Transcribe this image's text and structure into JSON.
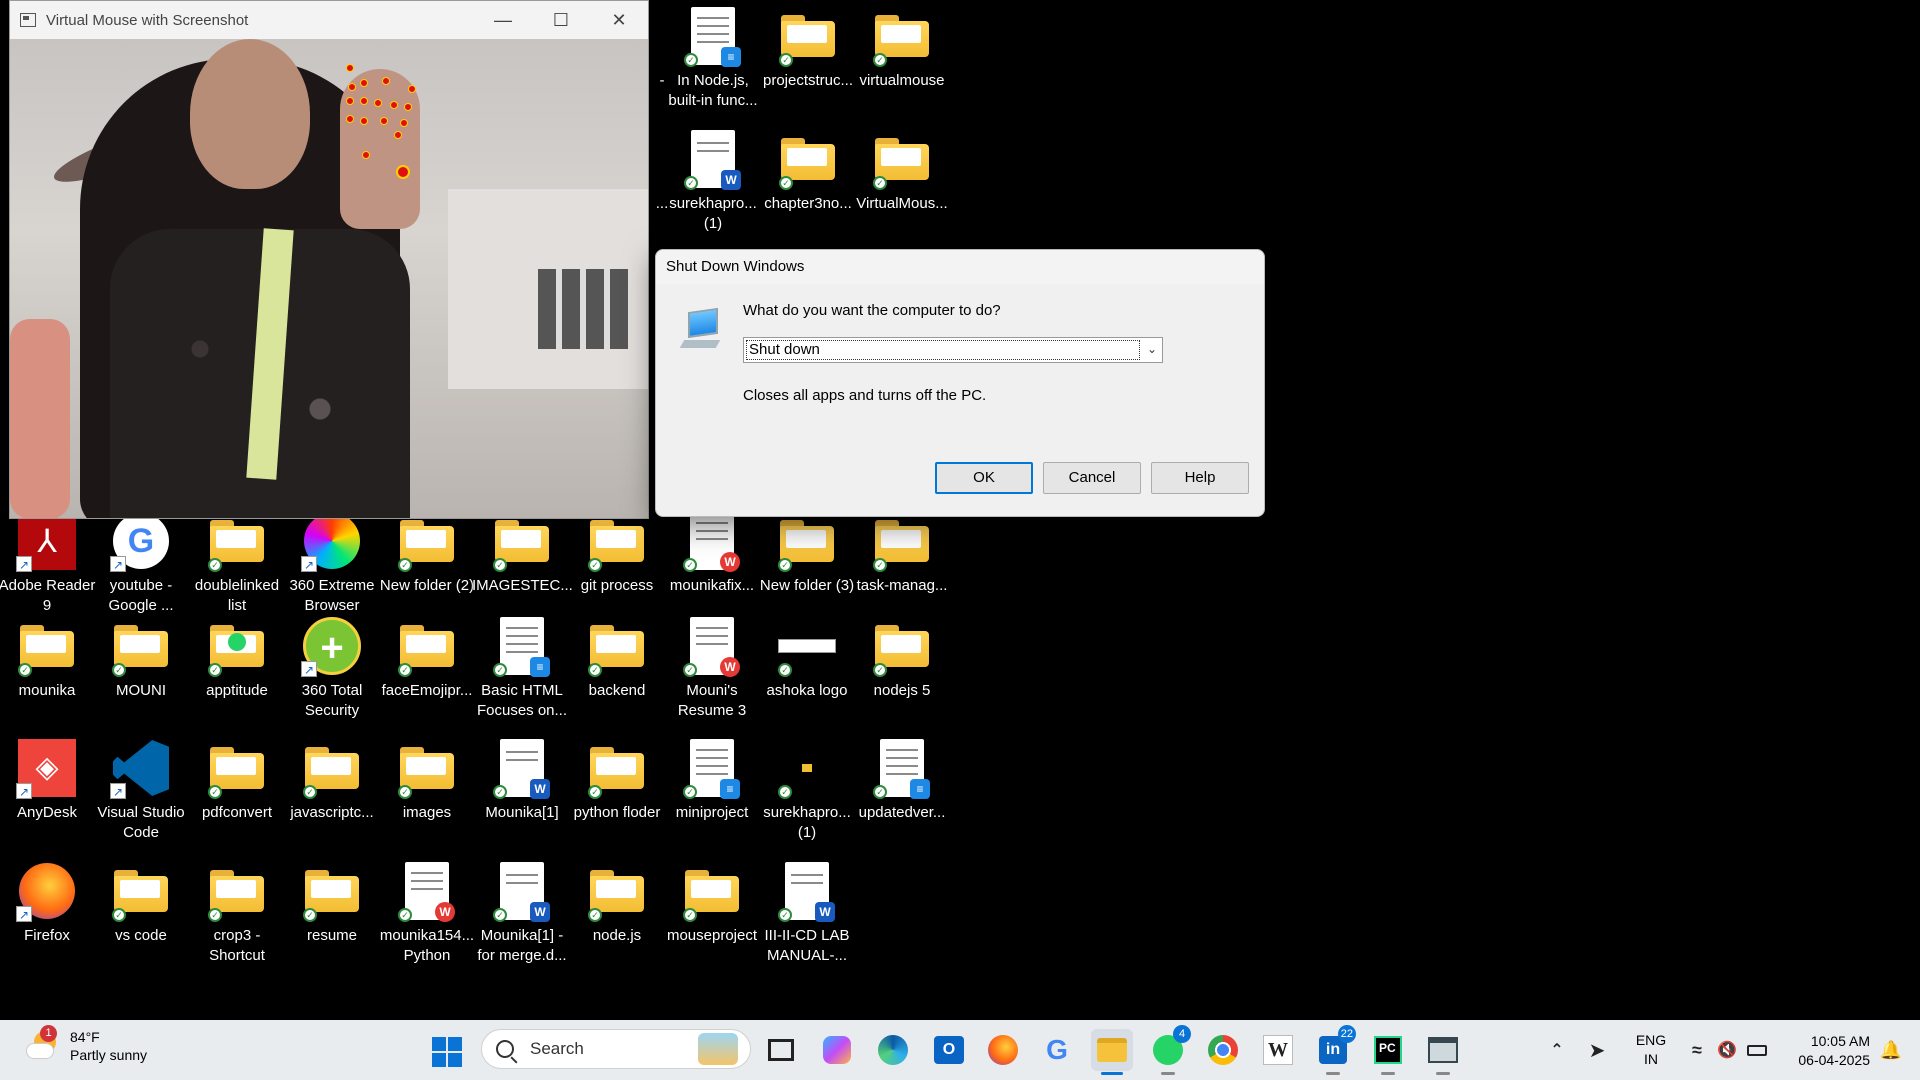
{
  "camera_window": {
    "title": "Virtual Mouse with Screenshot",
    "minimize": "—",
    "maximize": "☐",
    "close": "✕"
  },
  "dialog": {
    "title": "Shut Down Windows",
    "question": "What do you want the computer to do?",
    "selected_option": "Shut down",
    "description": "Closes all apps and turns off the PC.",
    "ok_label": "OK",
    "cancel_label": "Cancel",
    "help_label": "Help"
  },
  "desktop": {
    "top_icons": [
      {
        "label": "-",
        "kind": "dash"
      },
      {
        "label": "In Node.js, built-in func...",
        "kind": "doc-blue"
      },
      {
        "label": "projectstruc...",
        "kind": "folder"
      },
      {
        "label": "virtualmouse",
        "kind": "folder"
      },
      {
        "label": "...",
        "kind": "dash"
      },
      {
        "label": "surekhapro... (1)",
        "kind": "word"
      },
      {
        "label": "chapter3no...",
        "kind": "folder"
      },
      {
        "label": "VirtualMous...",
        "kind": "folder"
      }
    ],
    "row1": [
      {
        "label": "Adobe Reader 9",
        "kind": "adobe"
      },
      {
        "label": "youtube - Google ...",
        "kind": "google"
      },
      {
        "label": "doublelinked list",
        "kind": "folder"
      },
      {
        "label": "360 Extreme Browser",
        "kind": "browser360"
      },
      {
        "label": "New folder (2)",
        "kind": "folder"
      },
      {
        "label": "IMAGESTEC...",
        "kind": "folder"
      },
      {
        "label": "git process",
        "kind": "folder"
      },
      {
        "label": "mounikafix...",
        "kind": "doc-wps"
      },
      {
        "label": "New folder (3)",
        "kind": "folder"
      },
      {
        "label": "task-manag...",
        "kind": "folder"
      }
    ],
    "row2": [
      {
        "label": "mounika",
        "kind": "folder"
      },
      {
        "label": "MOUNI",
        "kind": "folder"
      },
      {
        "label": "apptitude",
        "kind": "folder-wa"
      },
      {
        "label": "360 Total Security",
        "kind": "security360"
      },
      {
        "label": "faceEmojipr...",
        "kind": "folder"
      },
      {
        "label": "Basic HTML Focuses on...",
        "kind": "doc-blue"
      },
      {
        "label": "backend",
        "kind": "folder"
      },
      {
        "label": "Mouni's Resume 3",
        "kind": "doc-wps"
      },
      {
        "label": "ashoka logo",
        "kind": "image"
      },
      {
        "label": "nodejs 5",
        "kind": "folder"
      }
    ],
    "row3": [
      {
        "label": "AnyDesk",
        "kind": "anydesk"
      },
      {
        "label": "Visual Studio Code",
        "kind": "vscode"
      },
      {
        "label": "pdfconvert",
        "kind": "folder"
      },
      {
        "label": "javascriptc...",
        "kind": "folder"
      },
      {
        "label": "images",
        "kind": "folder"
      },
      {
        "label": "Mounika[1]",
        "kind": "word"
      },
      {
        "label": "python floder",
        "kind": "folder"
      },
      {
        "label": "miniproject",
        "kind": "doc-blue"
      },
      {
        "label": "surekhapro... (1)",
        "kind": "tiny"
      },
      {
        "label": "updatedver...",
        "kind": "doc-blue"
      }
    ],
    "row4": [
      {
        "label": "Firefox",
        "kind": "firefox"
      },
      {
        "label": "vs code",
        "kind": "folder"
      },
      {
        "label": "crop3 - Shortcut",
        "kind": "folder"
      },
      {
        "label": "resume",
        "kind": "folder"
      },
      {
        "label": "mounika154... Python",
        "kind": "doc-wps"
      },
      {
        "label": "Mounika[1] - for merge.d...",
        "kind": "word"
      },
      {
        "label": "node.js",
        "kind": "folder"
      },
      {
        "label": "mouseproject",
        "kind": "folder"
      },
      {
        "label": "III-II-CD LAB MANUAL-...",
        "kind": "word"
      }
    ]
  },
  "taskbar": {
    "weather_badge": "1",
    "weather_temp": "84°F",
    "weather_desc": "Partly sunny",
    "search_placeholder": "Search",
    "whatsapp_badge": "4",
    "linkedin_badge": "22",
    "lang_line1": "ENG",
    "lang_line2": "IN",
    "time": "10:05 AM",
    "date": "06-04-2025"
  }
}
